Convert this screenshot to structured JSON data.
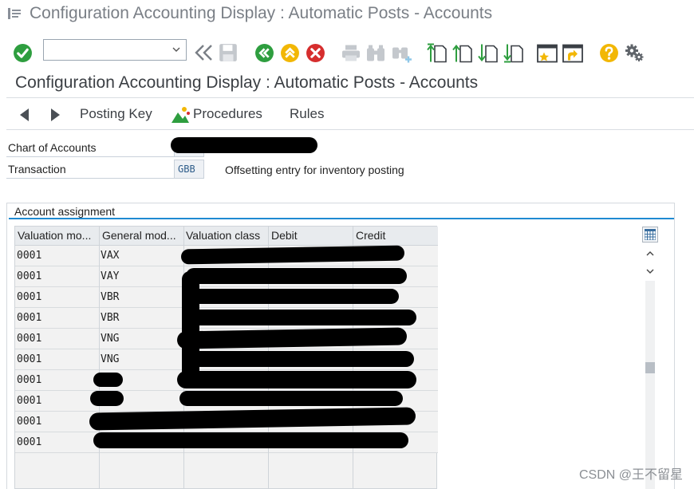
{
  "window": {
    "title": "Configuration Accounting Display : Automatic Posts - Accounts"
  },
  "toolbar": {
    "command_field_value": "",
    "icons": [
      "enter-icon",
      "dropdown-chevron-icon",
      "collapse-left-icon",
      "save-icon",
      "back-icon",
      "exit-icon",
      "cancel-icon",
      "print-icon",
      "find-icon",
      "find-next-icon",
      "first-page-icon",
      "previous-page-icon",
      "next-page-icon",
      "last-page-icon",
      "create-session-icon",
      "shortcut-icon",
      "help-icon",
      "settings-icon"
    ],
    "colors": {
      "enter": "#2e9e3f",
      "back": "#2e9e3f",
      "exit": "#f2b705",
      "cancel": "#d62e2e",
      "help": "#f2b705"
    }
  },
  "page": {
    "title": "Configuration Accounting Display : Automatic Posts - Accounts"
  },
  "app_toolbar": {
    "posting_key": "Posting Key",
    "procedures": "Procedures",
    "rules": "Rules"
  },
  "fields": {
    "chart_of_accounts_label": "Chart of Accounts",
    "chart_of_accounts_value": "",
    "transaction_label": "Transaction",
    "transaction_value": "GBB",
    "transaction_desc": "Offsetting entry for inventory posting"
  },
  "account_assignment": {
    "title": "Account assignment",
    "columns": [
      "Valuation mo...",
      "General mod...",
      "Valuation class",
      "Debit",
      "Credit"
    ],
    "rows": [
      {
        "valuation_modif": "0001",
        "general_modif": "VAX"
      },
      {
        "valuation_modif": "0001",
        "general_modif": "VAY"
      },
      {
        "valuation_modif": "0001",
        "general_modif": "VBR"
      },
      {
        "valuation_modif": "0001",
        "general_modif": "VBR"
      },
      {
        "valuation_modif": "0001",
        "general_modif": "VNG"
      },
      {
        "valuation_modif": "0001",
        "general_modif": "VNG"
      },
      {
        "valuation_modif": "0001",
        "general_modif": ""
      },
      {
        "valuation_modif": "0001",
        "general_modif": ""
      },
      {
        "valuation_modif": "0001",
        "general_modif": ""
      },
      {
        "valuation_modif": "0001",
        "general_modif": ""
      }
    ]
  },
  "watermark": "CSDN @王不留星"
}
